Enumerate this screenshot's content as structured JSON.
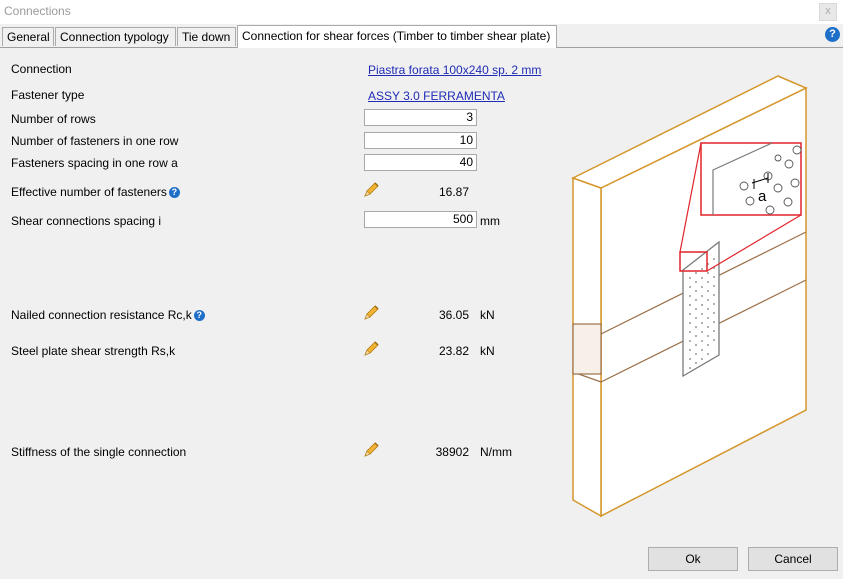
{
  "window": {
    "title": "Connections",
    "close_glyph": "x"
  },
  "tabs": [
    {
      "label": "General"
    },
    {
      "label": "Connection typology"
    },
    {
      "label": "Tie down"
    },
    {
      "label": "Connection for shear forces (Timber to timber shear plate)"
    }
  ],
  "help_glyph": "?",
  "form": {
    "connection_label": "Connection",
    "connection_value": "Piastra forata 100x240 sp. 2 mm",
    "fastener_type_label": "Fastener type",
    "fastener_type_value": "ASSY 3.0 FERRAMENTA",
    "rows_label": "Number of rows",
    "rows_value": "3",
    "fasteners_row_label": "Number of fasteners in one row",
    "fasteners_row_value": "10",
    "spacing_label": "Fasteners spacing in one row a",
    "spacing_value": "40",
    "effective_label": "Effective number of fasteners",
    "effective_value": "16.87",
    "shear_spacing_label": "Shear connections spacing i",
    "shear_spacing_value": "500",
    "shear_spacing_unit": "mm",
    "nailed_label": "Nailed connection resistance  Rc,k",
    "nailed_value": "36.05",
    "nailed_unit": "kN",
    "steel_label": "Steel plate shear strength Rs,k",
    "steel_value": "23.82",
    "steel_unit": "kN",
    "stiffness_label": "Stiffness of the single connection",
    "stiffness_value": "38902",
    "stiffness_unit": "N/mm"
  },
  "diagram": {
    "detail_label": "a"
  },
  "buttons": {
    "ok": "Ok",
    "cancel": "Cancel"
  },
  "colors": {
    "timber_edge": "#d4962a",
    "detail_box": "#e0242a",
    "plate": "#7a7a7a",
    "link": "#1f2bb4",
    "help": "#1e6fc8"
  }
}
